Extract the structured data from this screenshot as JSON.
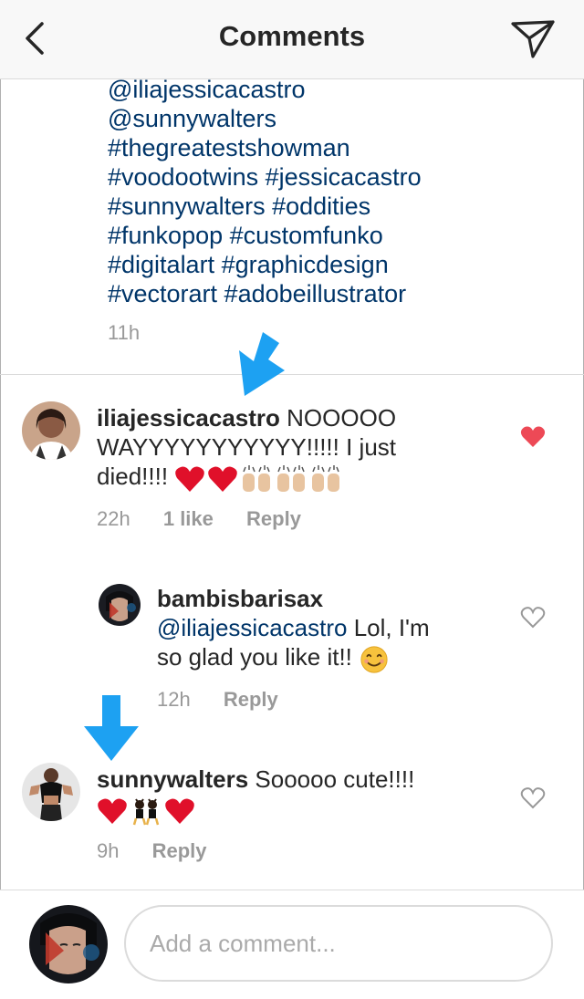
{
  "header": {
    "title": "Comments",
    "back_icon": "chevron-left-icon",
    "send_icon": "paper-plane-icon"
  },
  "caption": {
    "tag_lines": [
      "@iliajessicacastro",
      "@sunnywalters",
      "#thegreatestshowman",
      "#voodootwins #jessicacastro",
      "#sunnywalters #oddities",
      "#funkopop #customfunko",
      "#digitalart #graphicdesign",
      "#vectorart #adobeillustrator"
    ],
    "time": "11h"
  },
  "comments": [
    {
      "username": "iliajessicacastro",
      "text_line1": " NOOOOO",
      "text_line2": "WAYYYYYYYYYYY!!!!! I just",
      "text_line3": "died!!!! ",
      "emojis": [
        "red-heart",
        "red-heart",
        "raising-hands",
        "raising-hands",
        "raising-hands"
      ],
      "time": "22h",
      "likes": "1 like",
      "reply_label": "Reply",
      "liked": true,
      "like_icon": "heart-filled-icon",
      "like_color": "#ed4956"
    },
    {
      "username": "bambisbarisax",
      "mention": "@iliajessicacastro",
      "text_line1": " Lol, I'm",
      "text_line2": "so glad you like it!! ",
      "emojis": [
        "smiling-face"
      ],
      "time": "12h",
      "reply_label": "Reply",
      "liked": false,
      "like_icon": "heart-outline-icon"
    },
    {
      "username": "sunnywalters",
      "text_line1": " Sooooo cute!!!!",
      "emojis": [
        "red-heart",
        "dancing-women",
        "red-heart"
      ],
      "time": "9h",
      "reply_label": "Reply",
      "liked": false,
      "like_icon": "heart-outline-icon"
    }
  ],
  "annotation": {
    "arrow_color": "#1da1f2",
    "arrow_icon": "down-arrow-icon"
  },
  "compose": {
    "placeholder": "Add a comment..."
  },
  "colors": {
    "link_blue": "#003569",
    "meta_gray": "#999999",
    "like_red": "#ed4956"
  }
}
